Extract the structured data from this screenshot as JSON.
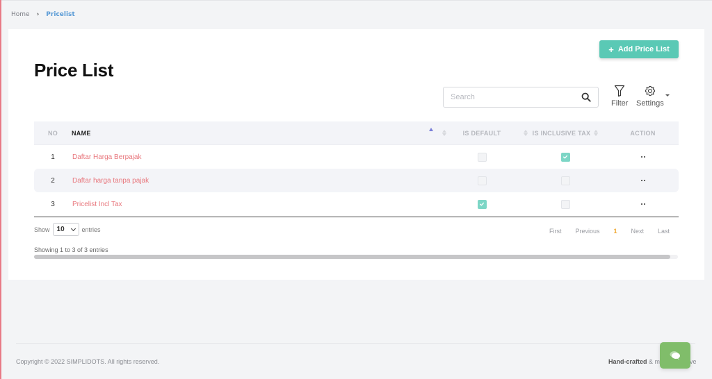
{
  "breadcrumb": {
    "home": "Home",
    "separator": "›",
    "current": "Pricelist"
  },
  "page": {
    "title": "Price List",
    "add_button_label": "Add Price List",
    "add_button_icon": "plus-icon"
  },
  "toolbar": {
    "search_placeholder": "Search",
    "search_value": "",
    "filter_label": "Filter",
    "settings_label": "Settings"
  },
  "table": {
    "columns": {
      "no": "NO",
      "name": "NAME",
      "is_default": "IS DEFAULT",
      "is_inclusive_tax": "IS INCLUSIVE TAX",
      "action": "ACTION"
    },
    "sorted_column": "name",
    "sort_direction": "asc",
    "rows": [
      {
        "no": "1",
        "name": "Daftar Harga Berpajak",
        "is_default": false,
        "is_inclusive_tax": true
      },
      {
        "no": "2",
        "name": "Daftar harga tanpa pajak",
        "is_default": false,
        "is_inclusive_tax": false
      },
      {
        "no": "3",
        "name": "Pricelist Incl Tax",
        "is_default": true,
        "is_inclusive_tax": false
      }
    ]
  },
  "length_menu": {
    "show_label": "Show",
    "selected": "10",
    "entries_label": "entries"
  },
  "info": "Showing 1 to 3 of 3 entries",
  "pagination": {
    "first": "First",
    "previous": "Previous",
    "current_page": "1",
    "next": "Next",
    "last": "Last"
  },
  "footer": {
    "copyright": "Copyright © 2022 SIMPLIDOTS. All rights reserved.",
    "handcrafted_bold": "Hand-crafted",
    "handcrafted_rest": " & made with love"
  },
  "colors": {
    "accent_teal": "#5ac9b5",
    "name_link": "#e8777d",
    "current_page": "#f0a830",
    "breadcrumb_active": "#5a9bd6",
    "chat_fab": "#80bd6a"
  }
}
